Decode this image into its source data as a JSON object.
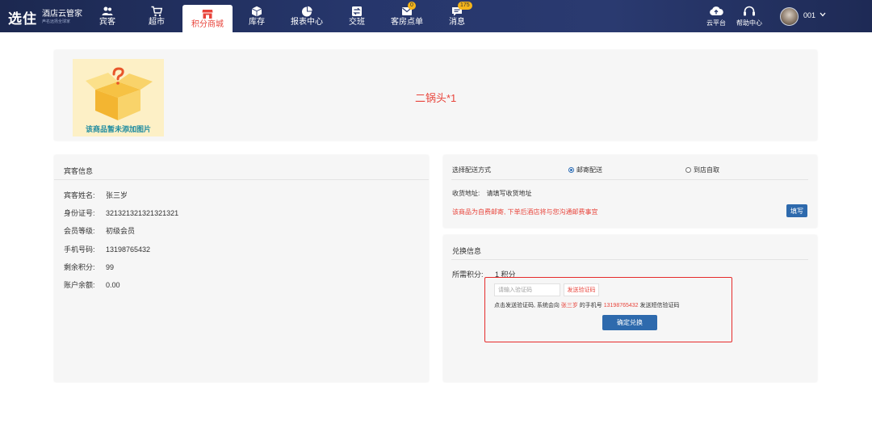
{
  "app": {
    "brand": "选住",
    "product": "酒店云管家",
    "tagline": "声名远扬全球家"
  },
  "nav": [
    {
      "label": "宾客",
      "icon": "guests-icon"
    },
    {
      "label": "超市",
      "icon": "cart-icon"
    },
    {
      "label": "积分商城",
      "icon": "store-icon",
      "active": true
    },
    {
      "label": "库存",
      "icon": "box-icon"
    },
    {
      "label": "报表中心",
      "icon": "pie-chart-icon"
    },
    {
      "label": "交班",
      "icon": "handover-icon"
    },
    {
      "label": "客房点单",
      "icon": "room-order-icon",
      "badge": "0"
    },
    {
      "label": "消息",
      "icon": "message-icon",
      "badge": "175"
    }
  ],
  "tools": [
    {
      "label": "云平台",
      "icon": "cloud-upload-icon"
    },
    {
      "label": "帮助中心",
      "icon": "headset-icon"
    }
  ],
  "user": {
    "name": "001"
  },
  "product": {
    "no_image_text": "该商品暂未添加图片",
    "title": "二锅头*1"
  },
  "guest": {
    "section_title": "宾客信息",
    "fields": [
      {
        "label": "宾客姓名:",
        "value": "张三岁"
      },
      {
        "label": "身份证号:",
        "value": "321321321321321321"
      },
      {
        "label": "会员等级:",
        "value": "初级会员"
      },
      {
        "label": "手机号码:",
        "value": "13198765432"
      },
      {
        "label": "剩余积分:",
        "value": "99"
      },
      {
        "label": "账户余额:",
        "value": "0.00"
      }
    ]
  },
  "shipping": {
    "label": "选择配送方式",
    "options": [
      "邮寄配送",
      "到店自取"
    ],
    "selected": "邮寄配送",
    "address_label": "收货地址:",
    "address_value": "请填写收货地址",
    "notice": "该商品为自费邮寄, 下单后酒店将与您沟通邮费事宜",
    "fill_button": "填写"
  },
  "redeem": {
    "section_title": "兑换信息",
    "points_label": "所需积分:",
    "points_value": "1 积分",
    "code_placeholder": "请输入验证码",
    "send_code": "发送验证码",
    "hint_prefix": "点击发送验证码, 系统会向",
    "hint_name": "张三岁",
    "hint_mid": "的手机号",
    "hint_phone": "13198765432",
    "hint_suffix": "发送短信验证码",
    "confirm_button": "确定兑换"
  },
  "colors": {
    "accent": "#e8453c",
    "primary": "#2e6aad",
    "nav_bg": "#26366b",
    "highlight_border": "#e62b2b"
  }
}
